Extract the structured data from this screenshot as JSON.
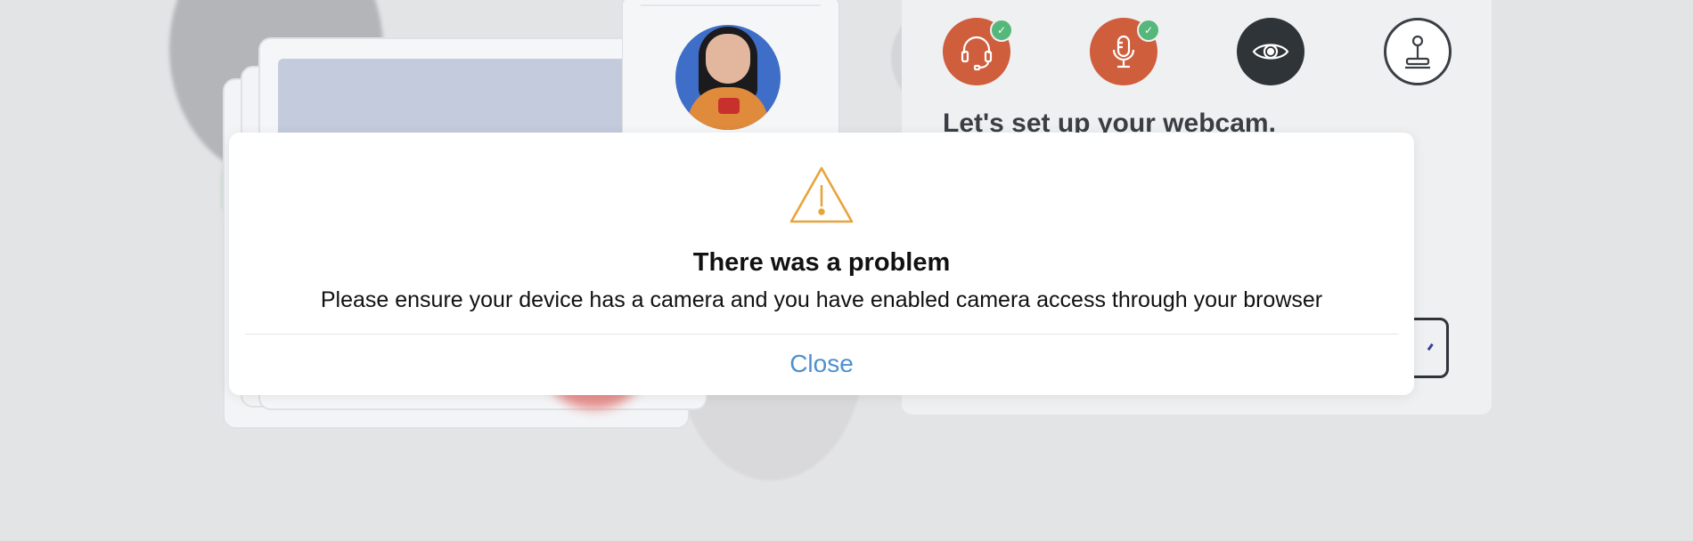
{
  "onboarding": {
    "title": "Let's set up your webcam.",
    "steps": [
      {
        "name": "headset",
        "icon": "headset-icon",
        "status": "done"
      },
      {
        "name": "microphone",
        "icon": "microphone-icon",
        "status": "done"
      },
      {
        "name": "webcam",
        "icon": "eye-icon",
        "status": "active"
      },
      {
        "name": "controller",
        "icon": "joystick-icon",
        "status": "todo"
      }
    ],
    "colors": {
      "done": "#cf5e3d",
      "active": "#2f3438",
      "check": "#55b87a"
    }
  },
  "modal": {
    "icon": "warning-icon",
    "icon_color": "#e8a43a",
    "title": "There was a problem",
    "message": "Please ensure your device has a camera and you have enabled camera access through your browser",
    "close_label": "Close",
    "close_color": "#4f8fd0"
  }
}
